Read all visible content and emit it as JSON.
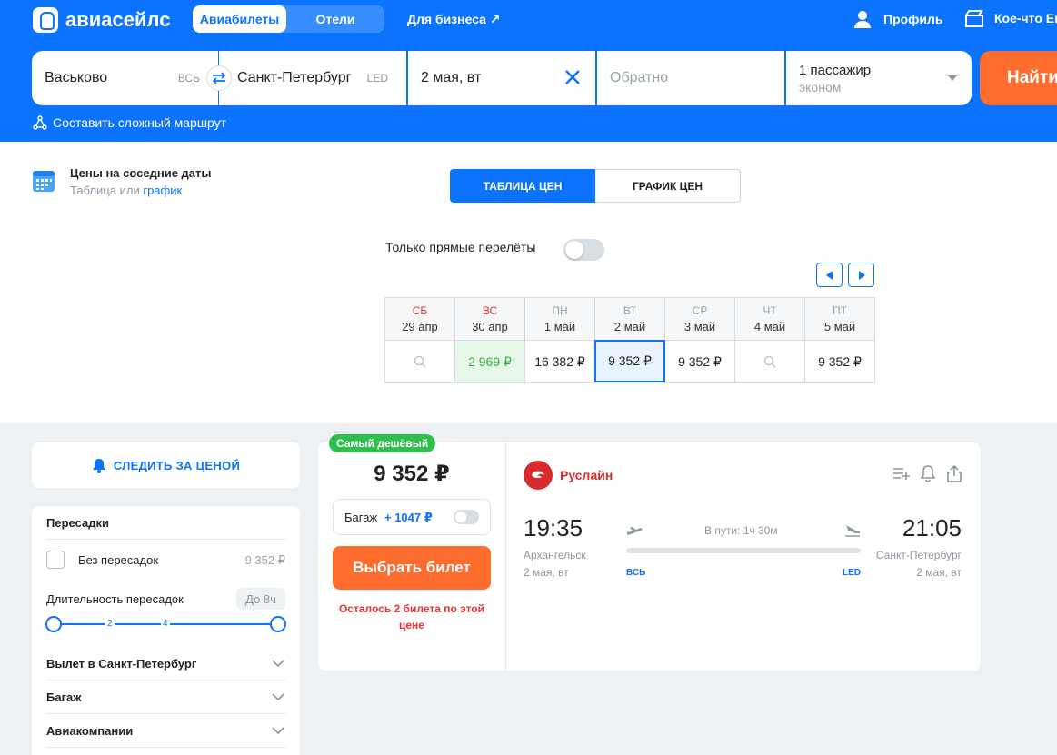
{
  "header": {
    "logo_text": "авиасейлс",
    "nav_tabs": [
      {
        "label": "Авиабилеты",
        "active": true
      },
      {
        "label": "Отели",
        "active": false
      }
    ],
    "business_link": "Для бизнеса ↗",
    "profile_label": "Профиль",
    "more_label": "Кое-что Ещё"
  },
  "search": {
    "from": {
      "value": "Васьково",
      "iata": "ВСЬ"
    },
    "to": {
      "value": "Санкт-Петербург",
      "iata": "LED"
    },
    "date": {
      "value": "2 мая, вт"
    },
    "return": {
      "placeholder": "Обратно"
    },
    "passengers": {
      "value": "1 пассажир",
      "class": "эконом"
    },
    "find_button": "Найти",
    "complex_route": "Составить сложный маршрут"
  },
  "prices": {
    "near_title": "Цены на соседние даты",
    "near_sub_table": "Таблица",
    "near_sub_or": " или ",
    "near_sub_graph": "график",
    "tabs": [
      {
        "label": "ТАБЛИЦА ЦЕН",
        "active": true
      },
      {
        "label": "ГРАФИК ЦЕН",
        "active": false
      }
    ],
    "direct_only": "Только прямые перелёты",
    "columns": [
      {
        "dow": "СБ",
        "date": "29 апр",
        "price": "",
        "weekend": true
      },
      {
        "dow": "ВС",
        "date": "30 апр",
        "price": "2 969 ₽",
        "weekend": true
      },
      {
        "dow": "ПН",
        "date": "1 май",
        "price": "16 382 ₽",
        "weekend": false
      },
      {
        "dow": "ВТ",
        "date": "2 май",
        "price": "9 352 ₽",
        "weekend": false
      },
      {
        "dow": "СР",
        "date": "3 май",
        "price": "9 352 ₽",
        "weekend": false
      },
      {
        "dow": "ЧТ",
        "date": "4 май",
        "price": "",
        "weekend": false
      },
      {
        "dow": "ПТ",
        "date": "5 май",
        "price": "9 352 ₽",
        "weekend": false
      }
    ]
  },
  "sidebar": {
    "follow_price": "СЛЕДИТЬ ЗА ЦЕНОЙ",
    "stops_title": "Пересадки",
    "nonstop_label": "Без пересадок",
    "nonstop_price": "9 352 ₽",
    "duration_label": "Длительность пересадок",
    "duration_badge": "До 8ч",
    "ticks": [
      "2",
      "4"
    ],
    "accordions": [
      "Вылет в Санкт-Петербург",
      "Багаж",
      "Авиакомпании"
    ]
  },
  "ticket": {
    "badge": "Самый дешёвый",
    "price": "9 352 ₽",
    "baggage_label": "Багаж",
    "baggage_price": "+ 1047 ₽",
    "choose_button": "Выбрать билет",
    "tickets_left": "Осталось 2 билета по этой цене",
    "airline": "Руслайн",
    "departure": {
      "time": "19:35",
      "city": "Архангельск",
      "date": "2 мая, вт",
      "iata": "ВСЬ"
    },
    "arrival": {
      "time": "21:05",
      "city": "Санкт-Петербург",
      "date": "2 мая, вт",
      "iata": "LED"
    },
    "duration": "В пути: 1ч 30м"
  },
  "colors": {
    "brand_blue": "#0c73fe",
    "cta_orange": "#ff6d2e",
    "badge_green": "#2fbf4c",
    "alert_red": "#e63333"
  }
}
